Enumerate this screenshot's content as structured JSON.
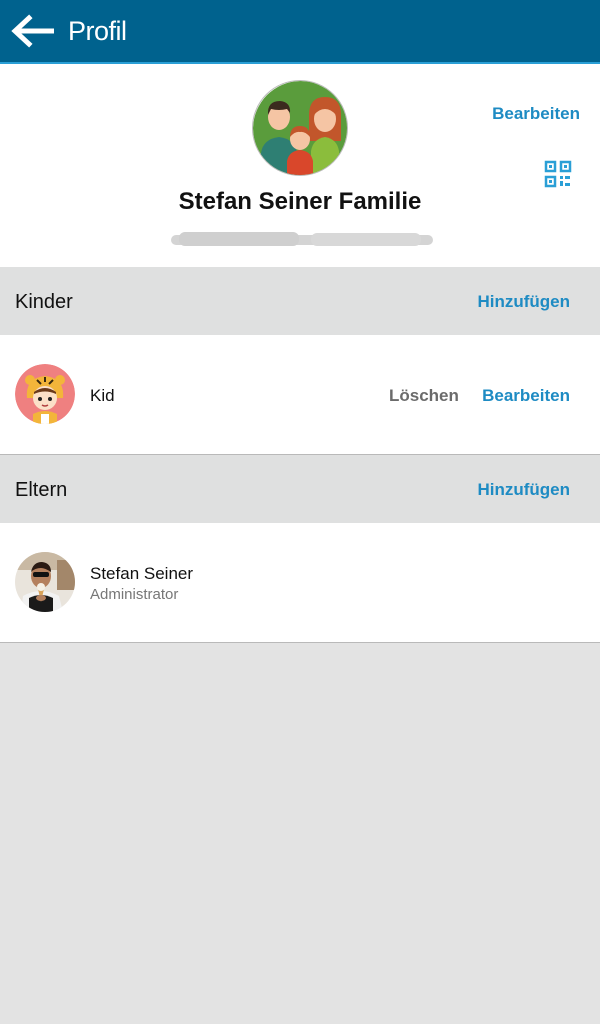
{
  "appbar": {
    "title": "Profil"
  },
  "profile": {
    "family_name": "Stefan Seiner Familie",
    "edit_label": "Bearbeiten"
  },
  "children_section": {
    "title": "Kinder",
    "add_label": "Hinzufügen",
    "items": [
      {
        "name": "Kid",
        "delete_label": "Löschen",
        "edit_label": "Bearbeiten"
      }
    ]
  },
  "parents_section": {
    "title": "Eltern",
    "add_label": "Hinzufügen",
    "items": [
      {
        "name": "Stefan Seiner",
        "role": "Administrator"
      }
    ]
  },
  "colors": {
    "appbar": "#00628e",
    "accent": "#1e8bc3",
    "section_bg": "#dfe0e0",
    "page_bg": "#e3e3e3"
  },
  "icons": [
    "back-arrow-icon",
    "qr-code-icon"
  ]
}
